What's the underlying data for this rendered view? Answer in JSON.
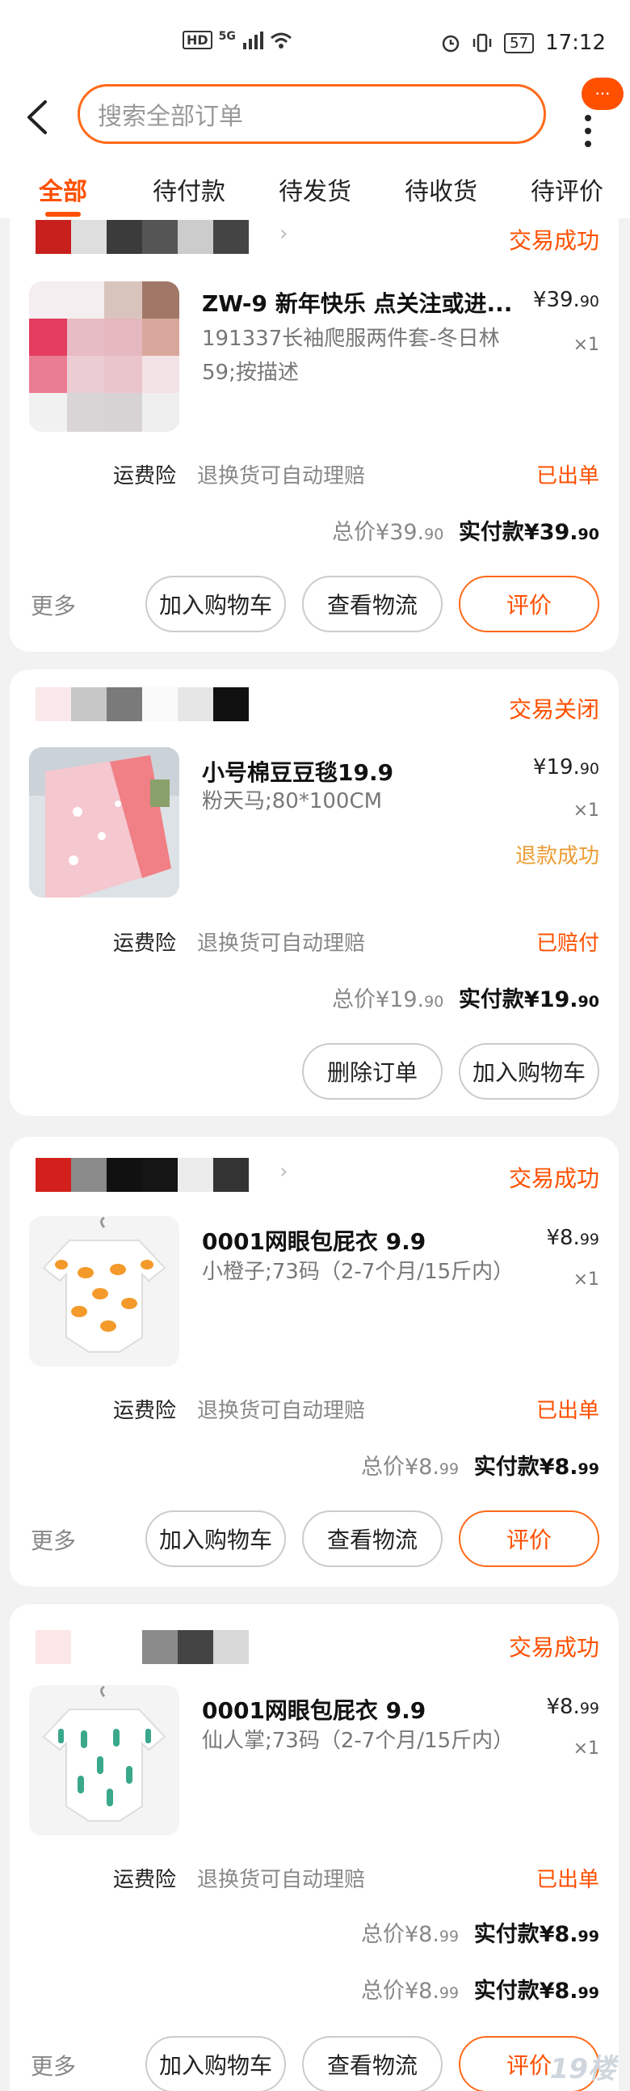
{
  "status_bar": {
    "hd": "HD",
    "network": "5G",
    "battery": "57",
    "time": "17:12",
    "icons": [
      "signal-icon",
      "wifi-icon",
      "alarm-icon",
      "vibrate-icon",
      "battery-icon"
    ]
  },
  "header": {
    "search_placeholder": "搜索全部订单",
    "badge": "···"
  },
  "tabs": [
    {
      "label": "全部",
      "active": true
    },
    {
      "label": "待付款",
      "active": false
    },
    {
      "label": "待发货",
      "active": false
    },
    {
      "label": "待收货",
      "active": false
    },
    {
      "label": "待评价",
      "active": false
    }
  ],
  "colors": {
    "accent": "#ff5000",
    "refund": "#ec9d35"
  },
  "orders": [
    {
      "status": "交易成功",
      "title": "ZW-9  新年快乐  点关注或进...",
      "spec": "191337长袖爬服两件套-冬日林59;按描述",
      "price_int": "¥39.",
      "price_dec": "90",
      "qty": "×1",
      "insurance_label": "运费险",
      "insurance_text": "退换货可自动理赔",
      "insurance_status": "已出单",
      "total_label": "总价",
      "total_int": "¥39.",
      "total_dec": "90",
      "paid_label": "实付款",
      "paid_int": "¥39.",
      "paid_dec": "90",
      "more": "更多",
      "buttons": [
        "加入购物车",
        "查看物流",
        "评价"
      ]
    },
    {
      "status": "交易关闭",
      "title": "小号棉豆豆毯19.9",
      "spec": "粉天马;80*100CM",
      "price_int": "¥19.",
      "price_dec": "90",
      "qty": "×1",
      "refund": "退款成功",
      "insurance_label": "运费险",
      "insurance_text": "退换货可自动理赔",
      "insurance_status": "已赔付",
      "total_label": "总价",
      "total_int": "¥19.",
      "total_dec": "90",
      "paid_label": "实付款",
      "paid_int": "¥19.",
      "paid_dec": "90",
      "buttons": [
        "删除订单",
        "加入购物车"
      ]
    },
    {
      "status": "交易成功",
      "title": "0001网眼包屁衣 9.9",
      "spec": "小橙子;73码（2-7个月/15斤内）",
      "price_int": "¥8.",
      "price_dec": "99",
      "qty": "×1",
      "insurance_label": "运费险",
      "insurance_text": "退换货可自动理赔",
      "insurance_status": "已出单",
      "total_label": "总价",
      "total_int": "¥8.",
      "total_dec": "99",
      "paid_label": "实付款",
      "paid_int": "¥8.",
      "paid_dec": "99",
      "more": "更多",
      "buttons": [
        "加入购物车",
        "查看物流",
        "评价"
      ]
    },
    {
      "status": "交易成功",
      "title": "0001网眼包屁衣 9.9",
      "spec": "仙人掌;73码（2-7个月/15斤内）",
      "price_int": "¥8.",
      "price_dec": "99",
      "qty": "×1",
      "insurance_label": "运费险",
      "insurance_text": "退换货可自动理赔",
      "insurance_status": "已出单",
      "total_label": "总价",
      "total_int": "¥8.",
      "total_dec": "99",
      "paid_label": "实付款",
      "paid_int": "¥8.",
      "paid_dec": "99",
      "total2_label": "总价",
      "total2_int": "¥8.",
      "total2_dec": "99",
      "paid2_label": "实付款",
      "paid2_int": "¥8.",
      "paid2_dec": "99",
      "more": "更多",
      "buttons": [
        "加入购物车",
        "查看物流",
        "评价"
      ]
    }
  ],
  "watermark": "19楼"
}
